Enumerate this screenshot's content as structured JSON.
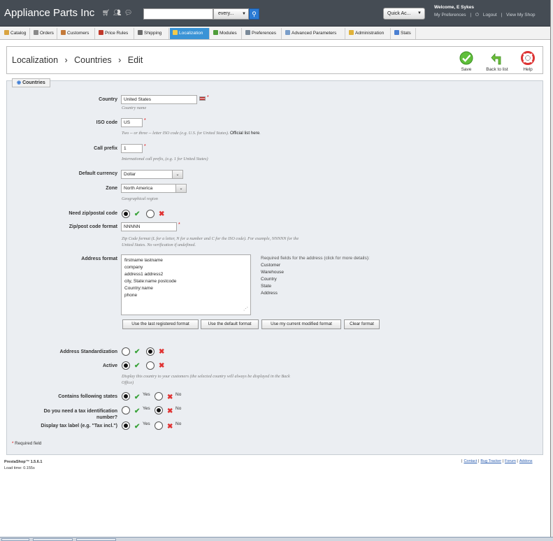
{
  "header": {
    "shop_name": "Appliance Parts Inc",
    "search": {
      "value": "",
      "scope": "every...",
      "button_icon": "search-icon"
    },
    "quick_access": "Quick Ac...",
    "welcome": "Welcome, E Sykes",
    "my_preferences": "My Preferences",
    "logout": "Logout",
    "view_shop": "View My Shop"
  },
  "tabs": [
    {
      "label": "Catalog",
      "icon": "catalog-icon",
      "color": "#d9a441"
    },
    {
      "label": "Orders",
      "icon": "orders-icon",
      "color": "#8a8a8a"
    },
    {
      "label": "Customers",
      "icon": "customers-icon",
      "color": "#c47a3a"
    },
    {
      "label": "Price Rules",
      "icon": "price-rules-icon",
      "color": "#c0392b"
    },
    {
      "label": "Shipping",
      "icon": "shipping-icon",
      "color": "#6b6b6b"
    },
    {
      "label": "Localization",
      "icon": "localization-icon",
      "color": "#f3c94a",
      "active": true
    },
    {
      "label": "Modules",
      "icon": "modules-icon",
      "color": "#4f9d3a"
    },
    {
      "label": "Preferences",
      "icon": "preferences-icon",
      "color": "#7a8a99"
    },
    {
      "label": "Advanced Parameters",
      "icon": "advanced-parameters-icon",
      "color": "#7a9ec9"
    },
    {
      "label": "Administration",
      "icon": "administration-icon",
      "color": "#e0b23a"
    },
    {
      "label": "Stats",
      "icon": "stats-icon",
      "color": "#4a7fd1"
    }
  ],
  "breadcrumb": {
    "items": [
      "Localization",
      "Countries",
      "Edit"
    ],
    "separator": "›"
  },
  "toolbar": {
    "save": "Save",
    "back": "Back to list",
    "help": "Help"
  },
  "panel": {
    "legend": "Countries"
  },
  "form": {
    "country": {
      "label": "Country",
      "value": "United States",
      "hint": "Country name"
    },
    "iso": {
      "label": "ISO code",
      "value": "US",
      "hint": "Two -- or three -- letter ISO code (e.g. U.S. for United States).",
      "link": "Official list here",
      "hint_end": "."
    },
    "call_prefix": {
      "label": "Call prefix",
      "value": "1",
      "hint": "International call prefix, (e.g. 1 for United States)"
    },
    "currency": {
      "label": "Default currency",
      "value": "Dollar"
    },
    "zone": {
      "label": "Zone",
      "value": "North America",
      "hint": "Geographical region"
    },
    "need_zip": {
      "label": "Need zip/postal code"
    },
    "zip_format": {
      "label": "Zip/post code format",
      "value": "NNNNN",
      "hint_line1": "Zip Code format (L for a letter, N for a number and C for the ISO code). For example, NNNNN for the",
      "hint_line2": "United States. No verification if undefined."
    },
    "address_format": {
      "label": "Address format",
      "lines": [
        "firstname lastname",
        "company",
        "address1 address2",
        "city, State:name postcode",
        "Country:name",
        "phone"
      ]
    },
    "required_fields": {
      "title": "Required fields for the address (click for more details):",
      "items": [
        "Customer",
        "Warehouse",
        "Country",
        "State",
        "Address"
      ]
    },
    "format_buttons": [
      "Use the last registered format",
      "Use the default format",
      "Use my current modified format",
      "Clear format"
    ],
    "standardization": {
      "label": "Address Standardization"
    },
    "active": {
      "label": "Active",
      "hint_line1": "Display this country to your customers (the selected country will always be displayed in the Back",
      "hint_line2": "Office)"
    },
    "contains_states": {
      "label": "Contains following states",
      "yes": "Yes",
      "no": "No"
    },
    "tax_id": {
      "label_line1": "Do you need a tax identification",
      "label_line2": "number?",
      "yes": "Yes",
      "no": "No"
    },
    "tax_label": {
      "label": "Display tax label (e.g. \"Tax incl.\")",
      "yes": "Yes",
      "no": "No"
    },
    "required_note": "Required field",
    "required_mark": "*"
  },
  "footer": {
    "version": "PrestaShop™ 1.5.6.1",
    "load_time": "Load time: 0.155s",
    "links": [
      "Contact",
      "Bug Tracker",
      "Forum",
      "Addons"
    ],
    "separator": "|"
  }
}
